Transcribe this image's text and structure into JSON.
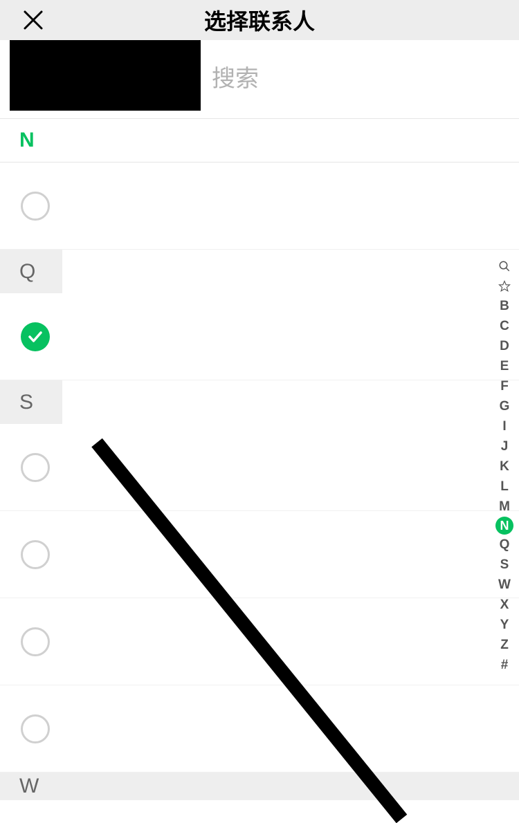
{
  "header": {
    "title": "选择联系人"
  },
  "search": {
    "placeholder": "搜索"
  },
  "sections": [
    {
      "letter": "N",
      "first": true,
      "items": [
        {
          "selected": false
        }
      ]
    },
    {
      "letter": "Q",
      "items": [
        {
          "selected": true
        }
      ]
    },
    {
      "letter": "S",
      "items": [
        {
          "selected": false
        },
        {
          "selected": false
        },
        {
          "selected": false
        },
        {
          "selected": false
        }
      ]
    },
    {
      "letter": "W",
      "items": []
    }
  ],
  "alpha_index": {
    "items": [
      "B",
      "C",
      "D",
      "E",
      "F",
      "G",
      "I",
      "J",
      "K",
      "L",
      "M",
      "N",
      "Q",
      "S",
      "W",
      "X",
      "Y",
      "Z",
      "#"
    ],
    "active": "N"
  },
  "colors": {
    "accent": "#07c160"
  }
}
